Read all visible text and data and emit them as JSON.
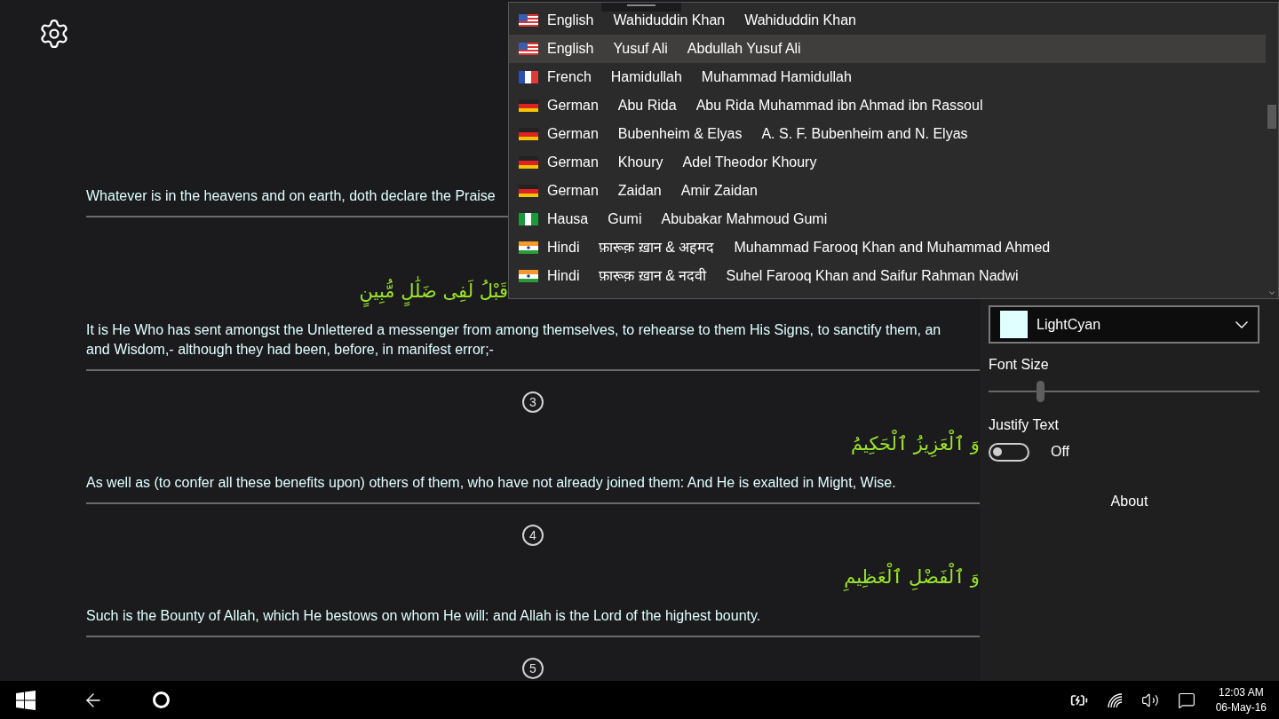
{
  "reader": {
    "verses": [
      {
        "lines": [
          "Whatever is in the heavens and on earth, doth declare the Praise"
        ]
      },
      {
        "arabic": "قَبْلُ لَفِى ضَلَٰلٍ مُّبِينٍ",
        "lines": [
          "It is He Who has sent amongst the Unlettered a messenger from among themselves, to rehearse to them His Signs, to sanctify them, an",
          "and Wisdom,- although they had been, before, in manifest error;-"
        ],
        "number": "3"
      },
      {
        "arabic": "وَ ٱلْعَزِيزُ ٱلْحَكِيمُ",
        "lines": [
          "As well as (to confer all these benefits upon) others of them, who have not already joined them: And He is exalted in Might, Wise."
        ],
        "number": "4"
      },
      {
        "arabic": "وَ ٱلْفَضْلِ ٱلْعَظِيمِ",
        "lines": [
          "Such is the Bounty of Allah, which He bestows on whom He will: and Allah is the Lord of the highest bounty."
        ],
        "number": "5"
      }
    ]
  },
  "translation_list": [
    {
      "kind": "us",
      "language": "English",
      "short_name": "Wahiduddin Khan",
      "full_name": "Wahiduddin Khan",
      "selected": false
    },
    {
      "kind": "us",
      "language": "English",
      "short_name": "Yusuf Ali",
      "full_name": "Abdullah Yusuf Ali",
      "selected": true
    },
    {
      "kind": "fr",
      "language": "French",
      "short_name": "Hamidullah",
      "full_name": "Muhammad Hamidullah",
      "selected": false
    },
    {
      "kind": "de",
      "language": "German",
      "short_name": "Abu Rida",
      "full_name": "Abu Rida Muhammad ibn Ahmad ibn Rassoul",
      "selected": false
    },
    {
      "kind": "de",
      "language": "German",
      "short_name": "Bubenheim & Elyas",
      "full_name": "A. S. F. Bubenheim and N. Elyas",
      "selected": false
    },
    {
      "kind": "de",
      "language": "German",
      "short_name": "Khoury",
      "full_name": "Adel Theodor Khoury",
      "selected": false
    },
    {
      "kind": "de",
      "language": "German",
      "short_name": "Zaidan",
      "full_name": "Amir Zaidan",
      "selected": false
    },
    {
      "kind": "ng",
      "language": "Hausa",
      "short_name": "Gumi",
      "full_name": "Abubakar Mahmoud Gumi",
      "selected": false
    },
    {
      "kind": "in",
      "language": "Hindi",
      "short_name": "फ़ारूक़ ख़ान & अहमद",
      "full_name": "Muhammad Farooq Khan and Muhammad Ahmed",
      "selected": false
    },
    {
      "kind": "in",
      "language": "Hindi",
      "short_name": "फ़ारूक़ ख़ान & नदवी",
      "full_name": "Suhel Farooq Khan and Saifur Rahman Nadwi",
      "selected": false
    }
  ],
  "settings": {
    "color_select": {
      "value": "LightCyan",
      "color": "#e0ffff"
    },
    "font_size": {
      "label": "Font Size",
      "level": 0.19
    },
    "justify_text": {
      "label": "Justify Text",
      "on": false,
      "state_label": "Off"
    },
    "about": "About"
  },
  "taskbar": {
    "time": "12:03 AM",
    "date": "06-May-16"
  }
}
